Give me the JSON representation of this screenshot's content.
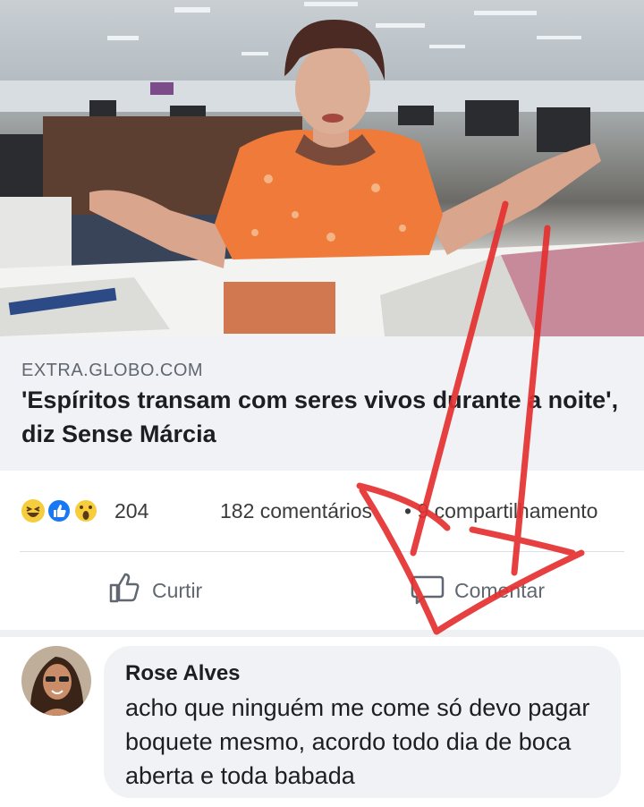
{
  "post": {
    "link_domain": "EXTRA.GLOBO.COM",
    "headline": "'Espíritos transam com seres vivos durante a noite', diz Sense Márcia",
    "reaction_count": "204",
    "comment_count": "182 comentários",
    "share_count": "• 9 compartilhamento",
    "reactions": [
      "haha-icon",
      "like-icon",
      "wow-icon"
    ]
  },
  "actions": {
    "like_label": "Curtir",
    "comment_label": "Comentar"
  },
  "comment": {
    "author": "Rose Alves",
    "text": "acho que ninguém me come só devo pagar boquete mesmo, acordo todo dia de boca aberta e toda babada"
  },
  "colors": {
    "link_box_bg": "#f0f2f5",
    "annotation_red": "#e53030",
    "shirt_orange": "#f07a3a"
  }
}
